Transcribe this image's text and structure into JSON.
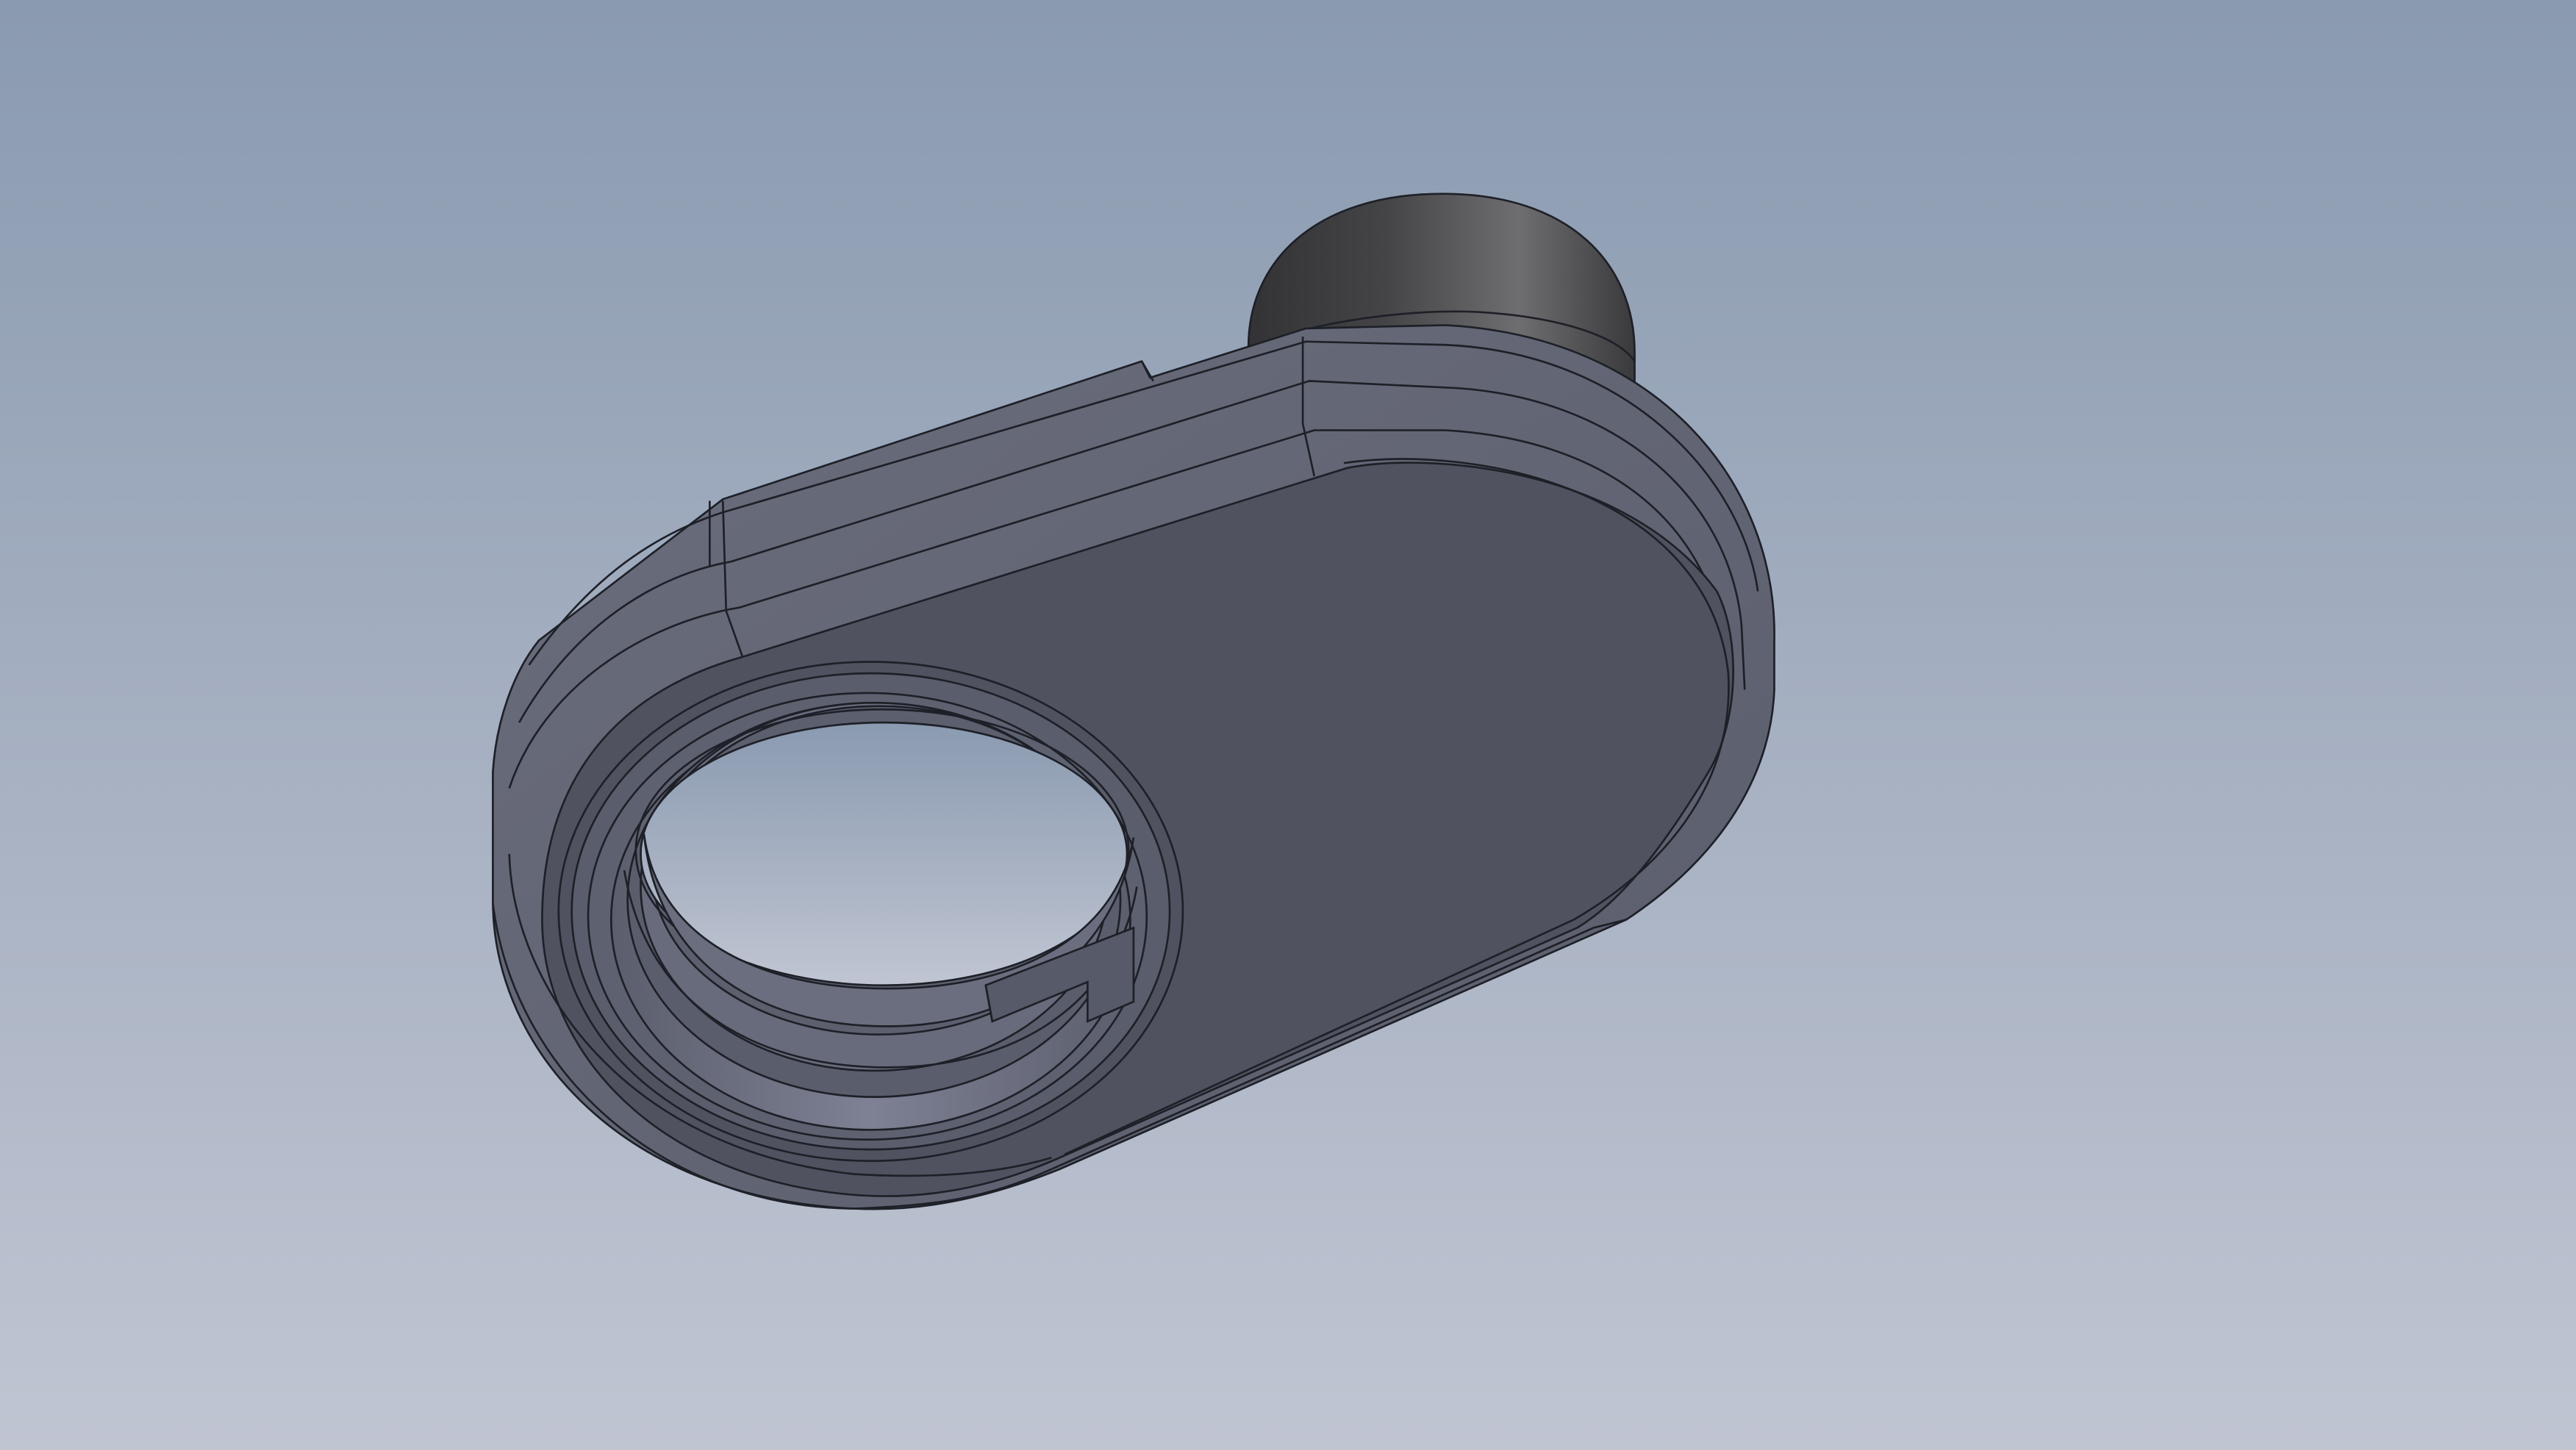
{
  "viewport": {
    "background_top_color": "#8a9ab0",
    "background_bottom_color": "#c0c5d2"
  },
  "model": {
    "name": "",
    "body_color": "#50535f",
    "edge_color": "#1e2028",
    "boss_color": "#3a3a3d",
    "boss_highlight_color": "#6e6e70"
  }
}
